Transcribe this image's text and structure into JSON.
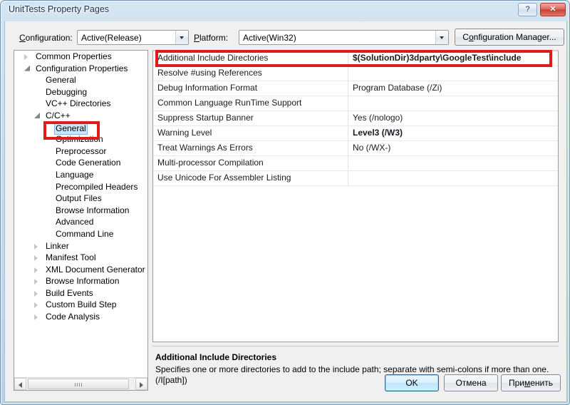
{
  "window": {
    "title": "UnitTests Property Pages",
    "help_button": "?",
    "close_button": "✕"
  },
  "config_bar": {
    "configuration_label": "Configuration:",
    "configuration_value": "Active(Release)",
    "platform_label": "Platform:",
    "platform_value": "Active(Win32)",
    "configuration_manager_button": "Configuration Manager..."
  },
  "tree": {
    "items": [
      {
        "label": "Common Properties",
        "level": 0,
        "state": "collapsed",
        "selected": false
      },
      {
        "label": "Configuration Properties",
        "level": 0,
        "state": "expanded",
        "selected": false
      },
      {
        "label": "General",
        "level": 1,
        "state": "leaf",
        "selected": false
      },
      {
        "label": "Debugging",
        "level": 1,
        "state": "leaf",
        "selected": false
      },
      {
        "label": "VC++ Directories",
        "level": 1,
        "state": "leaf",
        "selected": false
      },
      {
        "label": "C/C++",
        "level": 1,
        "state": "expanded",
        "selected": false
      },
      {
        "label": "General",
        "level": 2,
        "state": "leaf",
        "selected": true
      },
      {
        "label": "Optimization",
        "level": 2,
        "state": "leaf",
        "selected": false
      },
      {
        "label": "Preprocessor",
        "level": 2,
        "state": "leaf",
        "selected": false
      },
      {
        "label": "Code Generation",
        "level": 2,
        "state": "leaf",
        "selected": false
      },
      {
        "label": "Language",
        "level": 2,
        "state": "leaf",
        "selected": false
      },
      {
        "label": "Precompiled Headers",
        "level": 2,
        "state": "leaf",
        "selected": false
      },
      {
        "label": "Output Files",
        "level": 2,
        "state": "leaf",
        "selected": false
      },
      {
        "label": "Browse Information",
        "level": 2,
        "state": "leaf",
        "selected": false
      },
      {
        "label": "Advanced",
        "level": 2,
        "state": "leaf",
        "selected": false
      },
      {
        "label": "Command Line",
        "level": 2,
        "state": "leaf",
        "selected": false
      },
      {
        "label": "Linker",
        "level": 1,
        "state": "collapsed",
        "selected": false
      },
      {
        "label": "Manifest Tool",
        "level": 1,
        "state": "collapsed",
        "selected": false
      },
      {
        "label": "XML Document Generator",
        "level": 1,
        "state": "collapsed",
        "selected": false
      },
      {
        "label": "Browse Information",
        "level": 1,
        "state": "collapsed",
        "selected": false
      },
      {
        "label": "Build Events",
        "level": 1,
        "state": "collapsed",
        "selected": false
      },
      {
        "label": "Custom Build Step",
        "level": 1,
        "state": "collapsed",
        "selected": false
      },
      {
        "label": "Code Analysis",
        "level": 1,
        "state": "collapsed",
        "selected": false
      }
    ]
  },
  "property_grid": {
    "rows": [
      {
        "name": "Additional Include Directories",
        "value": "$(SolutionDir)3dparty\\GoogleTest\\include",
        "bold": true,
        "highlighted": true
      },
      {
        "name": "Resolve #using References",
        "value": "",
        "bold": false,
        "highlighted": false
      },
      {
        "name": "Debug Information Format",
        "value": "Program Database (/Zi)",
        "bold": false,
        "highlighted": false
      },
      {
        "name": "Common Language RunTime Support",
        "value": "",
        "bold": false,
        "highlighted": false
      },
      {
        "name": "Suppress Startup Banner",
        "value": "Yes (/nologo)",
        "bold": false,
        "highlighted": false
      },
      {
        "name": "Warning Level",
        "value": "Level3 (/W3)",
        "bold": true,
        "highlighted": false
      },
      {
        "name": "Treat Warnings As Errors",
        "value": "No (/WX-)",
        "bold": false,
        "highlighted": false
      },
      {
        "name": "Multi-processor Compilation",
        "value": "",
        "bold": false,
        "highlighted": false
      },
      {
        "name": "Use Unicode For Assembler Listing",
        "value": "",
        "bold": false,
        "highlighted": false
      }
    ]
  },
  "description": {
    "title": "Additional Include Directories",
    "body": "Specifies one or more directories to add to the include path; separate with semi-colons if more than one. (/I[path])"
  },
  "buttons": {
    "ok": "OK",
    "cancel": "Отмена",
    "apply_prefix": "При",
    "apply_accel": "м",
    "apply_suffix": "енить"
  },
  "colors": {
    "annotation_red": "#e01b1b",
    "selection_blue": "#cfe5f7",
    "focus_blue": "#2c628b"
  }
}
